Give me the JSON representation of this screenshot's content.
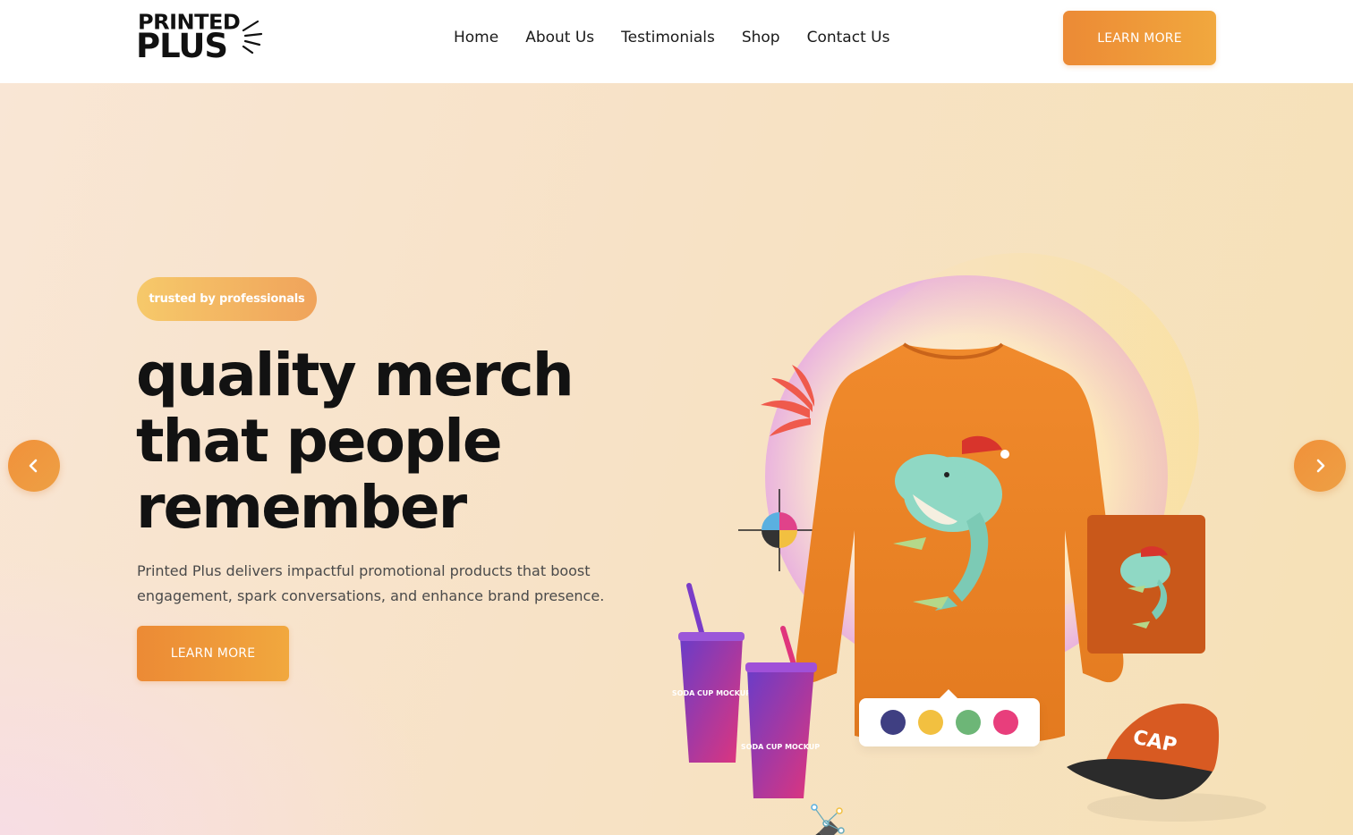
{
  "logo": {
    "line1": "PRINTED",
    "line2": "PLUS"
  },
  "nav": {
    "items": [
      {
        "label": "Home"
      },
      {
        "label": "About Us"
      },
      {
        "label": "Testimonials"
      },
      {
        "label": "Shop"
      },
      {
        "label": "Contact Us"
      }
    ]
  },
  "header": {
    "cta_label": "LEARN MORE"
  },
  "hero": {
    "badge": "trusted by professionals",
    "headline": [
      "quality merch",
      "that people",
      "remember"
    ],
    "description": "Printed Plus delivers impactful promotional products that boost engagement, spark conversations, and enhance brand presence.",
    "cta_label": "LEARN MORE",
    "prev_icon": "chevron-left-icon",
    "next_icon": "chevron-right-icon"
  },
  "illustration": {
    "cup_label": "SODA CUP MOCKUP",
    "cap_label": "CAP",
    "color_swatches": [
      "#3f3f82",
      "#f2c040",
      "#6db677",
      "#e83e7c"
    ]
  },
  "colors": {
    "accent": "#ec8a35",
    "accent_light": "#f1a83e",
    "text": "#121212"
  }
}
